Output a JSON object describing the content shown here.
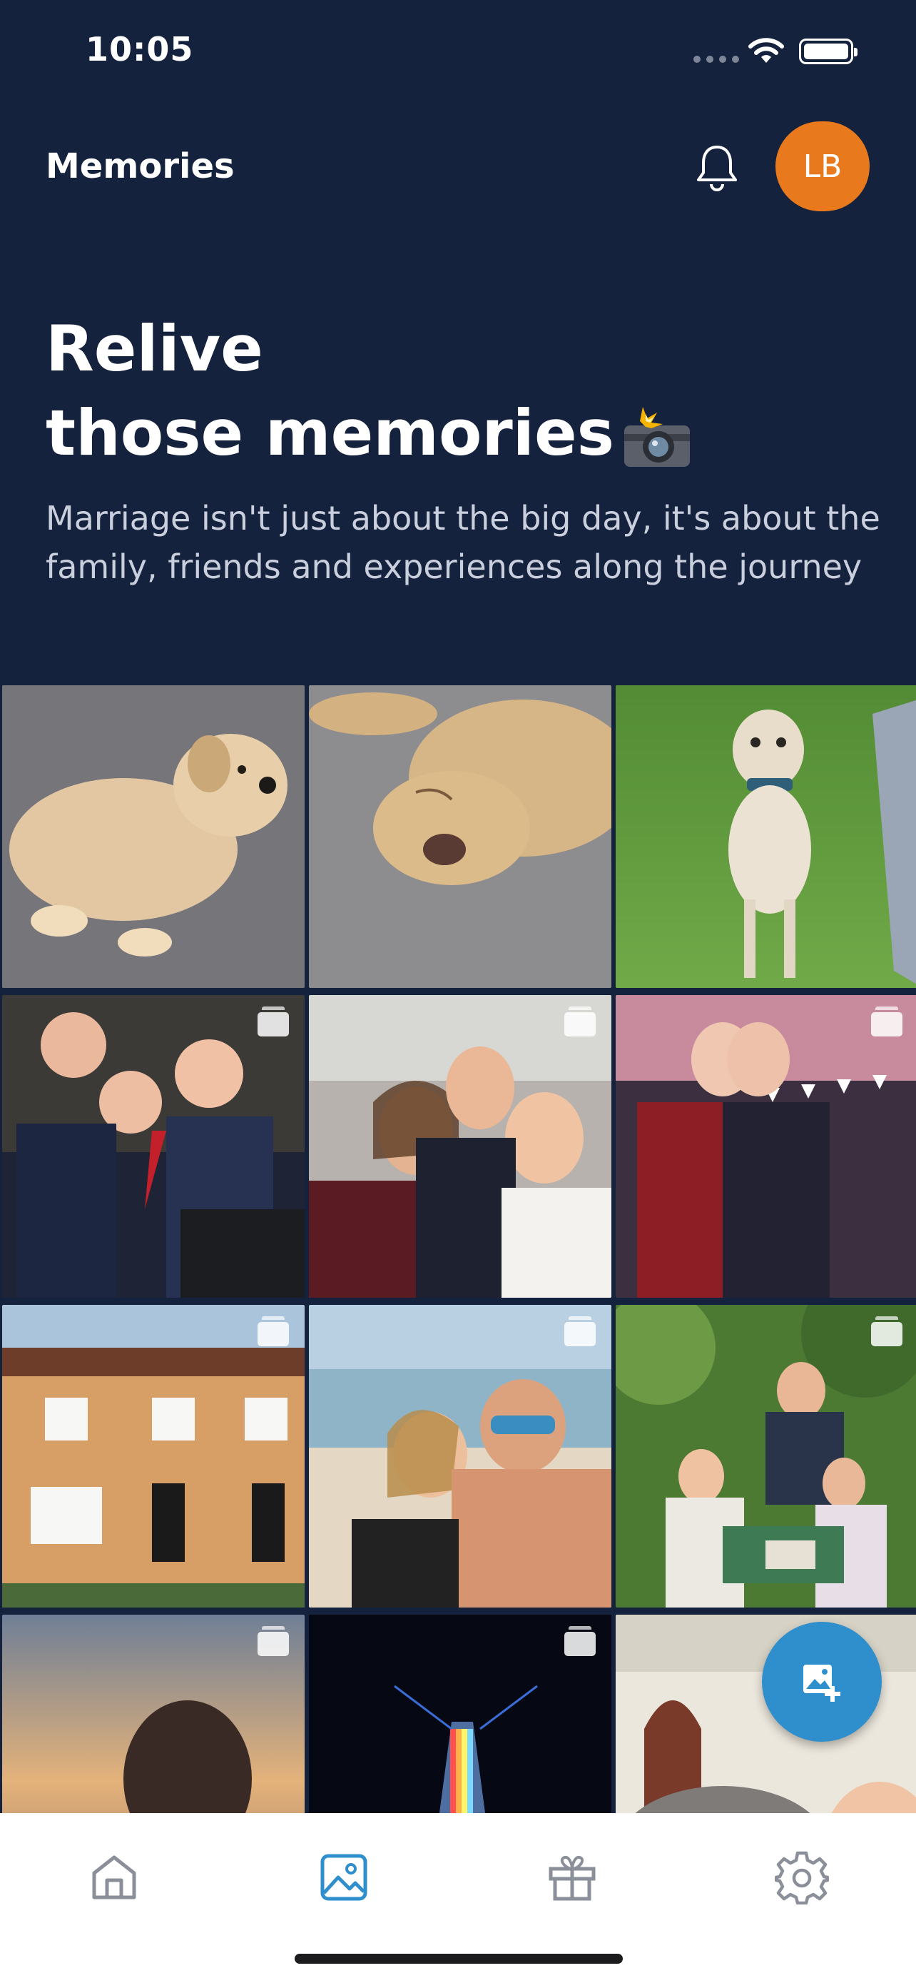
{
  "status_bar": {
    "time": "10:05"
  },
  "header": {
    "title": "Memories",
    "avatar_initials": "LB",
    "avatar_color": "#e8791d"
  },
  "hero": {
    "line1": "Relive",
    "line2": "those memories",
    "subtitle": "Marriage isn't just about the big day, it's about the family, friends and experiences along the journey"
  },
  "photos": [
    {
      "subject": "dog lying on carpet",
      "multi": false
    },
    {
      "subject": "dog sleeping on carpet",
      "multi": false
    },
    {
      "subject": "dog sitting on grass",
      "multi": false
    },
    {
      "subject": "group of men in suits",
      "multi": true
    },
    {
      "subject": "friends selfie",
      "multi": true
    },
    {
      "subject": "two women at party",
      "multi": true
    },
    {
      "subject": "house",
      "multi": true
    },
    {
      "subject": "couple on beach",
      "multi": true
    },
    {
      "subject": "family on bench",
      "multi": true
    },
    {
      "subject": "sunset",
      "multi": true
    },
    {
      "subject": "concert lights",
      "multi": true
    },
    {
      "subject": "elephants and woman",
      "multi": false
    }
  ],
  "tabs": [
    {
      "name": "home",
      "active": false
    },
    {
      "name": "photos",
      "active": true
    },
    {
      "name": "gifts",
      "active": false
    },
    {
      "name": "settings",
      "active": false
    }
  ],
  "colors": {
    "background": "#15223e",
    "accent": "#2f8fcc",
    "inactive_tab": "#8a8f99"
  }
}
